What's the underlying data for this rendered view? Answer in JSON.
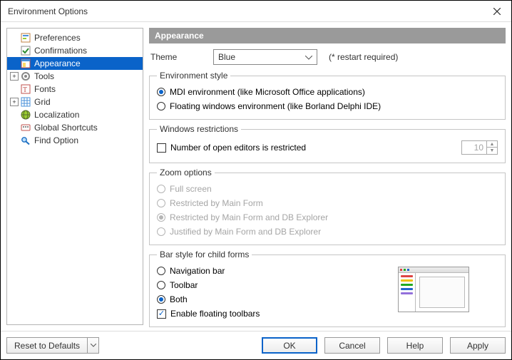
{
  "window": {
    "title": "Environment Options"
  },
  "tree": {
    "items": [
      {
        "label": "Preferences"
      },
      {
        "label": "Confirmations"
      },
      {
        "label": "Appearance"
      },
      {
        "label": "Tools"
      },
      {
        "label": "Fonts"
      },
      {
        "label": "Grid"
      },
      {
        "label": "Localization"
      },
      {
        "label": "Global Shortcuts"
      },
      {
        "label": "Find Option"
      }
    ]
  },
  "header": {
    "title": "Appearance"
  },
  "theme": {
    "label": "Theme",
    "value": "Blue",
    "hint": "(* restart required)"
  },
  "envstyle": {
    "legend": "Environment style",
    "mdi": "MDI environment (like Microsoft Office applications)",
    "floating": "Floating windows environment (like Borland Delphi IDE)"
  },
  "restrictions": {
    "legend": "Windows restrictions",
    "check_label": "Number of open editors is restricted",
    "value": "10"
  },
  "zoom": {
    "legend": "Zoom options",
    "o1": "Full screen",
    "o2": "Restricted by Main Form",
    "o3": "Restricted by Main Form and DB Explorer",
    "o4": "Justified by Main Form and DB Explorer"
  },
  "barstyle": {
    "legend": "Bar style for child forms",
    "nav": "Navigation bar",
    "toolbar": "Toolbar",
    "both": "Both",
    "floating": "Enable floating toolbars"
  },
  "footer": {
    "reset": "Reset to Defaults",
    "ok": "OK",
    "cancel": "Cancel",
    "help": "Help",
    "apply": "Apply"
  }
}
